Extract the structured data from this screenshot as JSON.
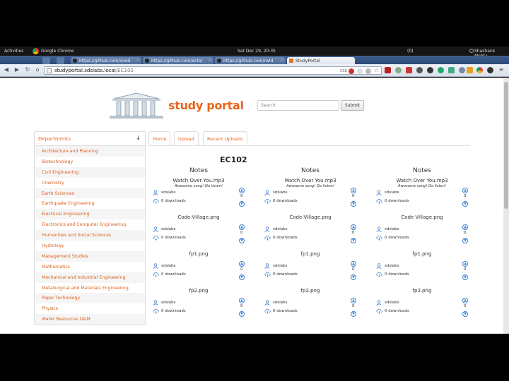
{
  "desktop": {
    "activities": "Activities",
    "app_name": "Google Chrome",
    "clock": "Sat Dec 29, 20:35",
    "tray": "(0)",
    "user": "Shashank Mehta"
  },
  "browser": {
    "tabs": [
      {
        "label": "https://github.com/vood"
      },
      {
        "label": "https://github.com/ecto/"
      },
      {
        "label": "https://github.com/rwld"
      },
      {
        "label": "StudyPortal"
      }
    ],
    "url_domain": "studyportal.sdslabs.local",
    "url_path": "/EC102",
    "css_badge": "CSS"
  },
  "site": {
    "logo_text": "study portal",
    "search_placeholder": "Search",
    "submit_label": "Submit"
  },
  "sidebar": {
    "header": "Departments",
    "items": [
      "Architecture and Planning",
      "Biotechnology",
      "Civil Engineering",
      "Chemistry",
      "Earth Sciences",
      "Earthquake Engineering",
      "Electrical Engineering",
      "Electronics and Computer Engineering",
      "Humanities and Social Sciences",
      "Hydrology",
      "Management Studies",
      "Mathematics",
      "Mechanical and Industrial Engineering",
      "Metallurgical and Materials Engineering",
      "Paper Technology",
      "Physics",
      "Water Resources D&M"
    ]
  },
  "nav": {
    "home": "Home",
    "upload": "Upload",
    "recent": "Recent Uploads"
  },
  "course": {
    "code": "EC102",
    "columns": [
      {
        "title": "Notes",
        "files": [
          {
            "name": "Watch Over You.mp3",
            "desc": "Awesome song! Do listen!",
            "uploader": "sdslabs",
            "downloads": "0 downloads",
            "votes": "0"
          },
          {
            "name": "Code Village.png",
            "desc": "",
            "uploader": "sdslabs",
            "downloads": "0 downloads",
            "votes": "0"
          },
          {
            "name": "fp1.png",
            "desc": "",
            "uploader": "sdslabs",
            "downloads": "0 downloads",
            "votes": "0"
          },
          {
            "name": "fp2.png",
            "desc": "",
            "uploader": "sdslabs",
            "downloads": "0 downloads",
            "votes": "0"
          }
        ]
      },
      {
        "title": "Notes",
        "files": [
          {
            "name": "Watch Over You.mp3",
            "desc": "Awesome song! Do listen!",
            "uploader": "sdslabs",
            "downloads": "0 downloads",
            "votes": "0"
          },
          {
            "name": "Code Village.png",
            "desc": "",
            "uploader": "sdslabs",
            "downloads": "0 downloads",
            "votes": "0"
          },
          {
            "name": "fp1.png",
            "desc": "",
            "uploader": "sdslabs",
            "downloads": "0 downloads",
            "votes": "0"
          },
          {
            "name": "fp2.png",
            "desc": "",
            "uploader": "sdslabs",
            "downloads": "0 downloads",
            "votes": "0"
          }
        ]
      },
      {
        "title": "Notes",
        "files": [
          {
            "name": "Watch Over You.mp3",
            "desc": "Awesome song! Do listen!",
            "uploader": "sdslabs",
            "downloads": "0 downloads",
            "votes": "0"
          },
          {
            "name": "Code Village.png",
            "desc": "",
            "uploader": "sdslabs",
            "downloads": "0 downloads",
            "votes": "0"
          },
          {
            "name": "fp1.png",
            "desc": "",
            "uploader": "sdslabs",
            "downloads": "0 downloads",
            "votes": "0"
          },
          {
            "name": "fp2.png",
            "desc": "",
            "uploader": "sdslabs",
            "downloads": "0 downloads",
            "votes": "0"
          }
        ]
      }
    ]
  },
  "colors": {
    "accent": "#e8661c",
    "vote_blue": "#3a7fd1",
    "chrome_frame": "#3f5f8e"
  }
}
